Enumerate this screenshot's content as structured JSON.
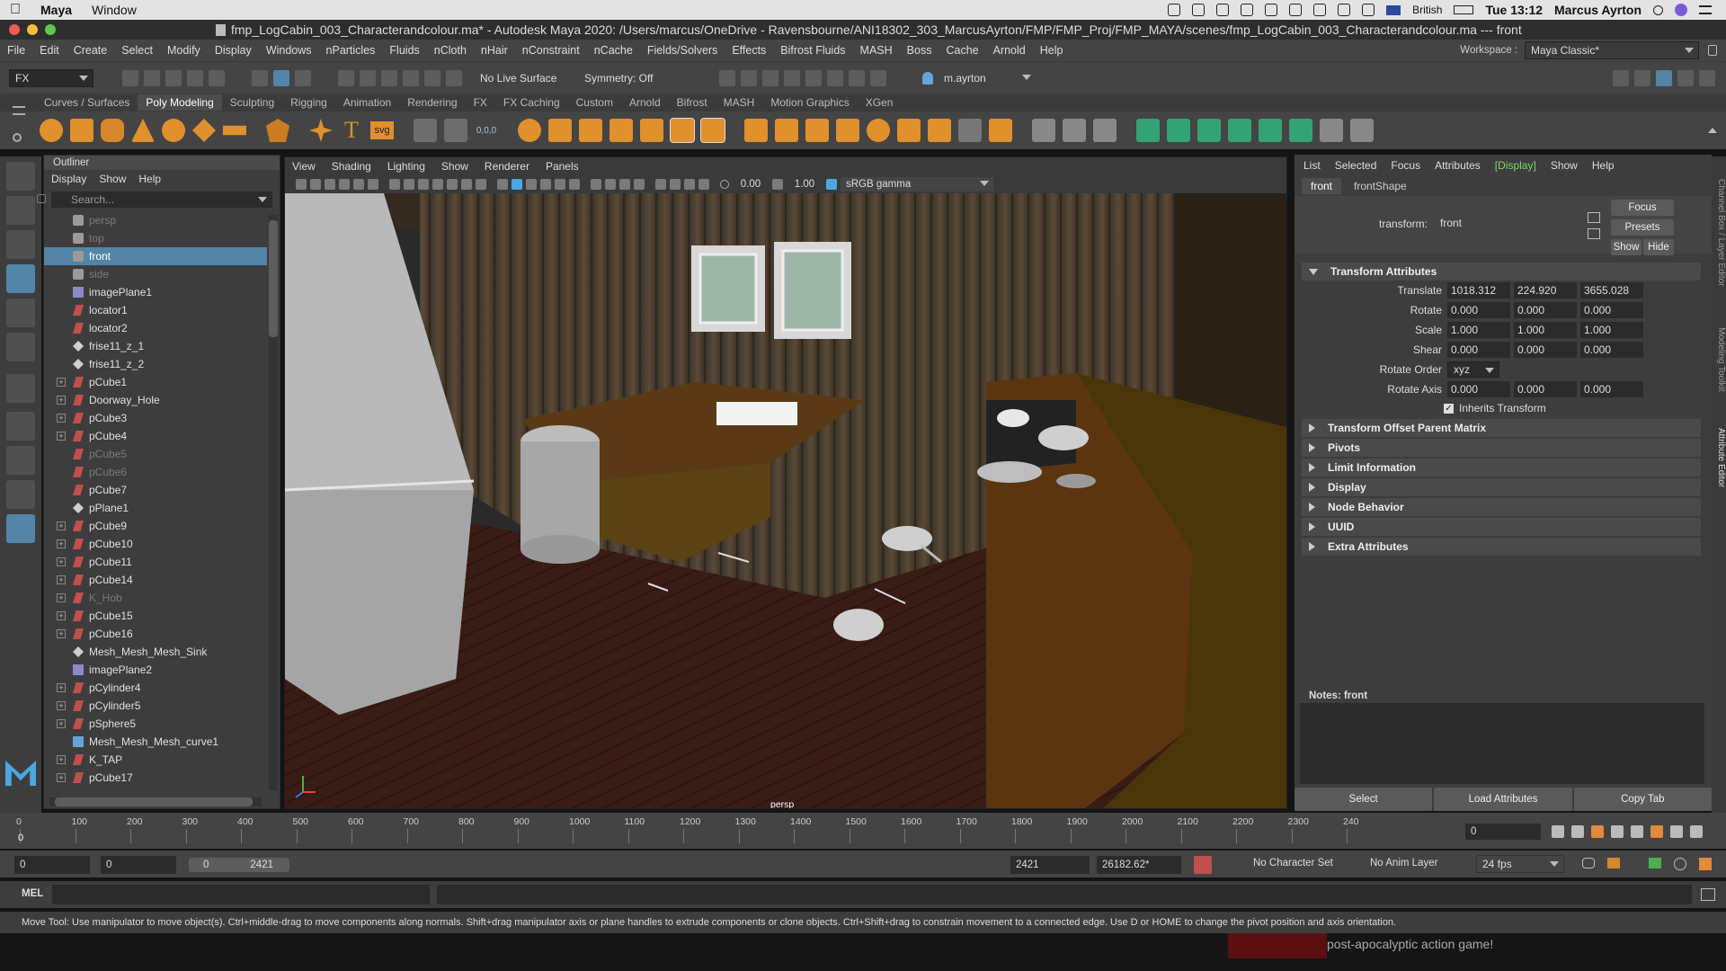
{
  "mac_menubar": {
    "app": "Maya",
    "menu": "Window",
    "keyboard": "British",
    "clock": "Tue 13:12",
    "user": "Marcus Ayrton"
  },
  "titlebar": {
    "title": "fmp_LogCabin_003_Characterandcolour.ma* - Autodesk Maya 2020: /Users/marcus/OneDrive - Ravensbourne/ANI18302_303_MarcusAyrton/FMP/FMP_Proj/FMP_MAYA/scenes/fmp_LogCabin_003_Characterandcolour.ma  ---  front"
  },
  "menubar": {
    "items": [
      "File",
      "Edit",
      "Create",
      "Select",
      "Modify",
      "Display",
      "Windows",
      "nParticles",
      "Fluids",
      "nCloth",
      "nHair",
      "nConstraint",
      "nCache",
      "Fields/Solvers",
      "Effects",
      "Bifrost Fluids",
      "MASH",
      "Boss",
      "Cache",
      "Arnold",
      "Help"
    ],
    "workspace_label": "Workspace :",
    "workspace_value": "Maya Classic*"
  },
  "statusline": {
    "menuset": "FX",
    "live_surface": "No Live Surface",
    "symmetry": "Symmetry: Off",
    "user": "m.ayrton"
  },
  "shelf": {
    "tabs": [
      "Curves / Surfaces",
      "Poly Modeling",
      "Sculpting",
      "Rigging",
      "Animation",
      "Rendering",
      "FX",
      "FX Caching",
      "Custom",
      "Arnold",
      "Bifrost",
      "MASH",
      "Motion Graphics",
      "XGen"
    ],
    "active_tab": "Poly Modeling",
    "text_tool": "T",
    "svg_tool": "svg",
    "counter_tool": "0,0,0"
  },
  "outliner": {
    "title": "Outliner",
    "menu": [
      "Display",
      "Show",
      "Help"
    ],
    "search_placeholder": "Search...",
    "items": [
      {
        "label": "persp",
        "kind": "camera",
        "dim": true,
        "expand": false
      },
      {
        "label": "top",
        "kind": "camera",
        "dim": true,
        "expand": false
      },
      {
        "label": "front",
        "kind": "camera",
        "selected": true,
        "expand": false
      },
      {
        "label": "side",
        "kind": "camera",
        "dim": true,
        "expand": false
      },
      {
        "label": "imagePlane1",
        "kind": "image",
        "expand": false
      },
      {
        "label": "locator1",
        "kind": "mesh",
        "expand": false
      },
      {
        "label": "locator2",
        "kind": "mesh",
        "expand": false
      },
      {
        "label": "frise11_z_1",
        "kind": "locator",
        "expand": false
      },
      {
        "label": "frise11_z_2",
        "kind": "locator",
        "expand": false
      },
      {
        "label": "pCube1",
        "kind": "mesh",
        "expand": true
      },
      {
        "label": "Doorway_Hole",
        "kind": "mesh",
        "expand": true
      },
      {
        "label": "pCube3",
        "kind": "mesh",
        "expand": true
      },
      {
        "label": "pCube4",
        "kind": "mesh",
        "expand": true
      },
      {
        "label": "pCube5",
        "kind": "mesh",
        "dim": true,
        "expand": false
      },
      {
        "label": "pCube6",
        "kind": "mesh",
        "dim": true,
        "expand": false
      },
      {
        "label": "pCube7",
        "kind": "mesh",
        "expand": false
      },
      {
        "label": "pPlane1",
        "kind": "locator",
        "expand": false
      },
      {
        "label": "pCube9",
        "kind": "mesh",
        "expand": true
      },
      {
        "label": "pCube10",
        "kind": "mesh",
        "expand": true
      },
      {
        "label": "pCube11",
        "kind": "mesh",
        "expand": true
      },
      {
        "label": "pCube14",
        "kind": "mesh",
        "expand": true
      },
      {
        "label": "K_Hob",
        "kind": "mesh",
        "dim": true,
        "expand": true
      },
      {
        "label": "pCube15",
        "kind": "mesh",
        "expand": true
      },
      {
        "label": "pCube16",
        "kind": "mesh",
        "expand": true
      },
      {
        "label": "Mesh_Mesh_Mesh_Sink",
        "kind": "locator",
        "expand": false
      },
      {
        "label": "imagePlane2",
        "kind": "image",
        "expand": false
      },
      {
        "label": "pCylinder4",
        "kind": "mesh",
        "expand": true
      },
      {
        "label": "pCylinder5",
        "kind": "mesh",
        "expand": true
      },
      {
        "label": "pSphere5",
        "kind": "mesh",
        "expand": true
      },
      {
        "label": "Mesh_Mesh_Mesh_curve1",
        "kind": "curve",
        "expand": false
      },
      {
        "label": "K_TAP",
        "kind": "mesh",
        "expand": true
      },
      {
        "label": "pCube17",
        "kind": "mesh",
        "expand": true
      }
    ]
  },
  "viewport": {
    "menu": [
      "View",
      "Shading",
      "Lighting",
      "Show",
      "Renderer",
      "Panels"
    ],
    "exposure": "0.00",
    "gamma": "1.00",
    "color_space": "sRGB gamma",
    "camera_label": "persp"
  },
  "attribute_editor": {
    "menu": [
      "List",
      "Selected",
      "Focus",
      "Attributes",
      "Display",
      "Show",
      "Help"
    ],
    "active_menu": "Display",
    "tabs": [
      "front",
      "frontShape"
    ],
    "active_tab": "front",
    "transform_label": "transform:",
    "transform_value": "front",
    "buttons": {
      "focus": "Focus",
      "presets": "Presets",
      "show": "Show",
      "hide": "Hide"
    },
    "transform_attributes": {
      "title": "Transform Attributes",
      "translate": {
        "label": "Translate",
        "values": [
          "1018.312",
          "224.920",
          "3655.028"
        ]
      },
      "rotate": {
        "label": "Rotate",
        "values": [
          "0.000",
          "0.000",
          "0.000"
        ]
      },
      "scale": {
        "label": "Scale",
        "values": [
          "1.000",
          "1.000",
          "1.000"
        ]
      },
      "shear": {
        "label": "Shear",
        "values": [
          "0.000",
          "0.000",
          "0.000"
        ]
      },
      "rotate_order": {
        "label": "Rotate Order",
        "value": "xyz"
      },
      "rotate_axis": {
        "label": "Rotate Axis",
        "values": [
          "0.000",
          "0.000",
          "0.000"
        ]
      },
      "inherits": "Inherits Transform"
    },
    "sections": [
      "Transform Offset Parent Matrix",
      "Pivots",
      "Limit Information",
      "Display",
      "Node Behavior",
      "UUID",
      "Extra Attributes"
    ],
    "notes_label": "Notes:  front",
    "bottom_buttons": [
      "Select",
      "Load Attributes",
      "Copy Tab"
    ],
    "side_tabs": [
      "Channel Box / Layer Editor",
      "Modeling Toolkit",
      "Attribute Editor"
    ]
  },
  "timeline": {
    "ticks": [
      "0",
      "100",
      "200",
      "300",
      "400",
      "500",
      "600",
      "700",
      "800",
      "900",
      "1000",
      "1100",
      "1200",
      "1300",
      "1400",
      "1500",
      "1600",
      "1700",
      "1800",
      "1900",
      "2000",
      "2100",
      "2200",
      "2300",
      "240"
    ],
    "current_frame": "0",
    "current_frame_marker": "0"
  },
  "range": {
    "start": "0",
    "anim_start": "0",
    "slider_start": "0",
    "slider_end": "2421",
    "anim_end": "2421",
    "end": "26182.62*",
    "character_set": "No Character Set",
    "anim_layer": "No Anim Layer",
    "fps": "24 fps"
  },
  "command_line": {
    "label": "MEL"
  },
  "help_line": "Move Tool: Use manipulator to move object(s). Ctrl+middle-drag to move components along normals. Shift+drag manipulator axis or plane handles to extrude components or clone objects. Ctrl+Shift+drag to constrain movement to a connected edge. Use D or HOME to change the pivot position and axis orientation.",
  "background_text": "post-apocalyptic action game!",
  "colors": {
    "selection": "#5285a6",
    "panel": "#444444",
    "mesh_red": "#c0504d",
    "camera_gray": "#9a9a9a"
  }
}
